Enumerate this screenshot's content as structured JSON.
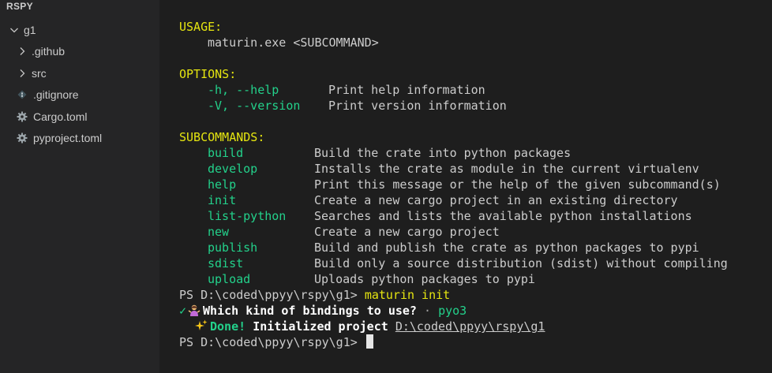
{
  "sidebar": {
    "header": "RSPY",
    "items": [
      {
        "label": "g1",
        "kind": "folder-open"
      },
      {
        "label": ".github",
        "kind": "folder-closed"
      },
      {
        "label": "src",
        "kind": "folder-closed"
      },
      {
        "label": ".gitignore",
        "kind": "file-gitignore"
      },
      {
        "label": "Cargo.toml",
        "kind": "file-toml"
      },
      {
        "label": "pyproject.toml",
        "kind": "file-toml"
      }
    ]
  },
  "terminal": {
    "usage_header": "USAGE:",
    "usage_line": "maturin.exe <SUBCOMMAND>",
    "options_header": "OPTIONS:",
    "options": [
      {
        "flag": "-h, --help",
        "desc": "Print help information"
      },
      {
        "flag": "-V, --version",
        "desc": "Print version information"
      }
    ],
    "subcommands_header": "SUBCOMMANDS:",
    "subcommands": [
      {
        "name": "build",
        "desc": "Build the crate into python packages"
      },
      {
        "name": "develop",
        "desc": "Installs the crate as module in the current virtualenv"
      },
      {
        "name": "help",
        "desc": "Print this message or the help of the given subcommand(s)"
      },
      {
        "name": "init",
        "desc": "Create a new cargo project in an existing directory"
      },
      {
        "name": "list-python",
        "desc": "Searches and lists the available python installations"
      },
      {
        "name": "new",
        "desc": "Create a new cargo project"
      },
      {
        "name": "publish",
        "desc": "Build and publish the crate as python packages to pypi"
      },
      {
        "name": "sdist",
        "desc": "Build only a source distribution (sdist) without compiling"
      },
      {
        "name": "upload",
        "desc": "Uploads python packages to pypi"
      }
    ],
    "prompt1": "PS D:\\coded\\ppyy\\rspy\\g1> ",
    "command1": "maturin init",
    "check_mark": "✓",
    "question": "Which kind of bindings to use?",
    "separator": " · ",
    "answer": "pyo3",
    "done_label": "Done!",
    "done_text": "Initialized project",
    "done_path": "D:\\coded\\ppyy\\rspy\\g1",
    "prompt2": "PS D:\\coded\\ppyy\\rspy\\g1> "
  },
  "colors": {
    "yellow": "#e5e510",
    "green": "#23d18b",
    "sidebar_bg": "#252526",
    "terminal_bg": "#1e1e1e"
  }
}
